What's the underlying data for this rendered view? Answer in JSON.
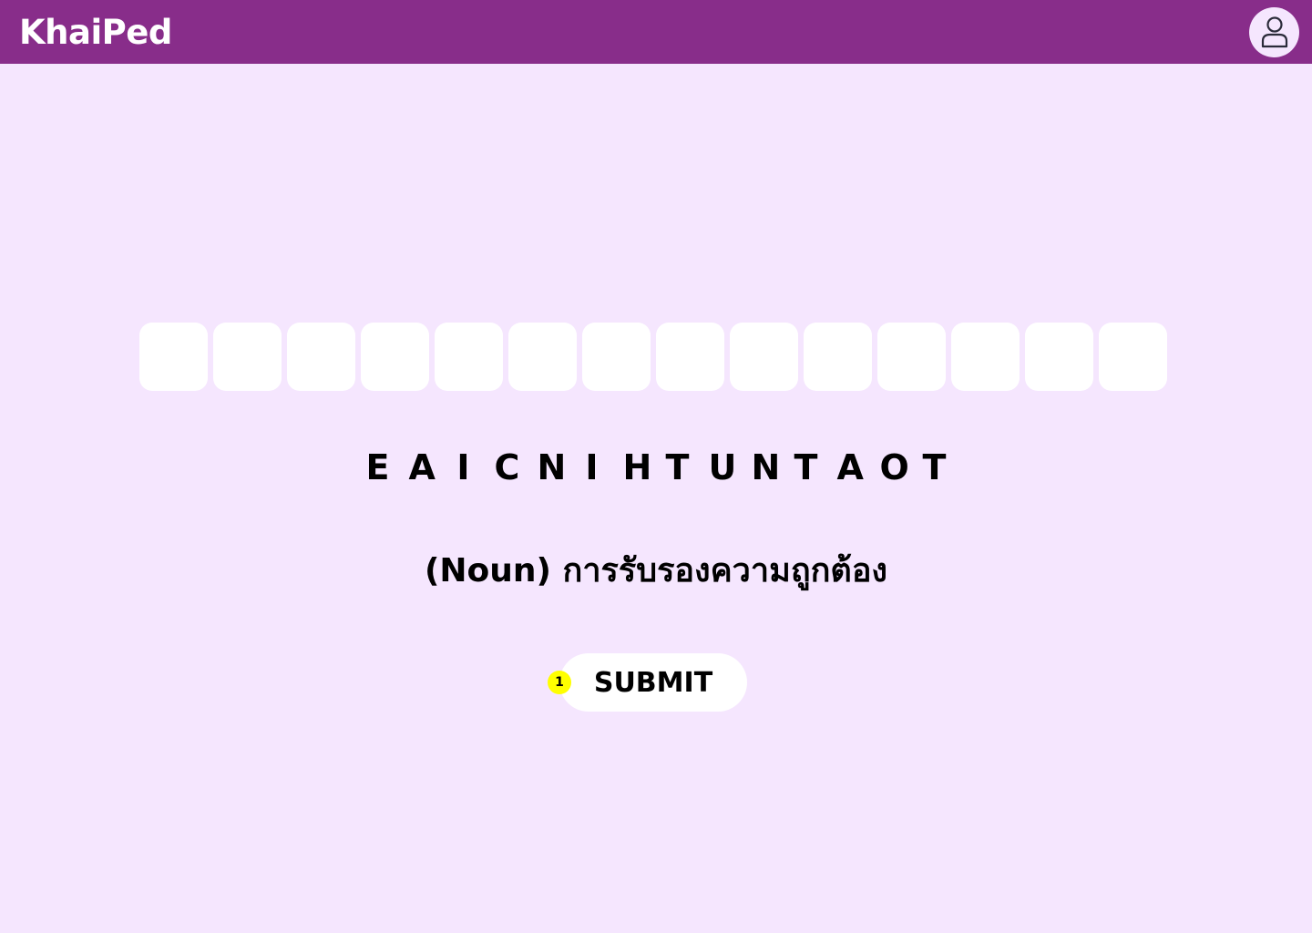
{
  "colors": {
    "header_bg": "#882d8a",
    "page_bg": "#f5e6fe",
    "slot_bg": "#ffffff",
    "avatar_bg": "#f5e6fe",
    "badge_bg": "#ffff00",
    "text": "#000000"
  },
  "header": {
    "logo": "KhaiPed",
    "avatar_icon": "user-icon"
  },
  "puzzle": {
    "slot_count": 14,
    "scrambled_letters": [
      "E",
      "A",
      "I",
      "C",
      "N",
      "I",
      "H",
      "T",
      "U",
      "N",
      "T",
      "A",
      "O",
      "T"
    ],
    "hint": "(Noun) การรับรองความถูกต้อง"
  },
  "submit": {
    "label": "SUBMIT",
    "badge": "1"
  }
}
